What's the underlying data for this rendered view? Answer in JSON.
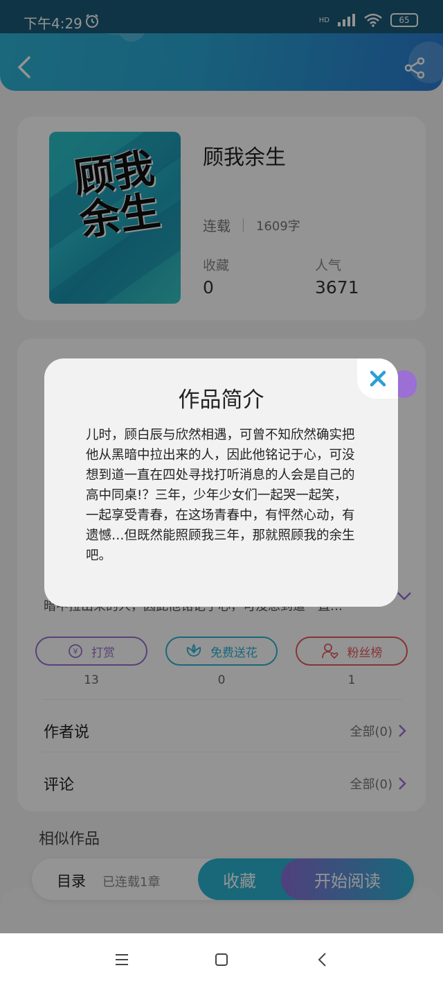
{
  "status_bar": {
    "time": "下午4:29",
    "battery": "65",
    "network": "HD"
  },
  "book": {
    "title": "顾我余生",
    "cover_text": "顾我余生",
    "serial_status": "连载",
    "word_count": "1609字",
    "favorites_label": "收藏",
    "favorites_value": "0",
    "popularity_label": "人气",
    "popularity_value": "3671"
  },
  "intro_snippet": "暗中拉出来的人，因此他铭记于心，可没想到道一直…",
  "gifts": [
    {
      "label": "打赏",
      "count": "13",
      "color": "#9b6fd3"
    },
    {
      "label": "免费送花",
      "count": "0",
      "color": "#2ab3d3"
    },
    {
      "label": "粉丝榜",
      "count": "1",
      "color": "#e8585a"
    }
  ],
  "author_says": {
    "title": "作者说",
    "more": "全部(0)"
  },
  "comments": {
    "title": "评论",
    "more": "全部(0)"
  },
  "similar_title": "相似作品",
  "bottom_bar": {
    "toc": "目录",
    "toc_status": "已连载1章",
    "collect": "收藏",
    "read": "开始阅读"
  },
  "modal": {
    "title": "作品简介",
    "body": "儿时，顾白辰与欣然相遇，可曾不知欣然确实把他从黑暗中拉出来的人，因此他铭记于心，可没想到道一直在四处寻找打听消息的人会是自己的高中同桌!？三年，少年少女们一起哭一起笑，一起享受青春，在这场青春中，有怦然心动，有遗憾…但既然能照顾我三年，那就照顾我的余生吧。"
  },
  "colors": {
    "accent": "#2ab3d3",
    "purple": "#9b6fd3",
    "red": "#e8585a"
  }
}
